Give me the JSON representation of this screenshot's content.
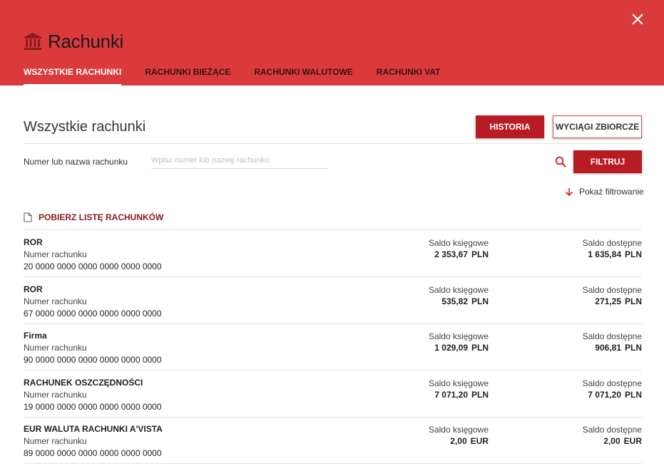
{
  "header": {
    "title": "Rachunki",
    "tabs": [
      {
        "label": "WSZYSTKIE RACHUNKI",
        "active": true
      },
      {
        "label": "RACHUNKI BIEŻĄCE",
        "active": false
      },
      {
        "label": "RACHUNKI WALUTOWE",
        "active": false
      },
      {
        "label": "RACHUNKI VAT",
        "active": false
      }
    ],
    "colors": {
      "background": "#db3a3d",
      "accent": "#b71c24"
    },
    "icons": {
      "title": "bank-icon",
      "close": "close-icon"
    }
  },
  "main": {
    "title": "Wszystkie rachunki",
    "history_button": "HISTORIA",
    "statements_button": "WYCIĄGI ZBIORCZE",
    "filter": {
      "label": "Numer lub nazwa rachunku",
      "value": "",
      "placeholder": "Wpisz numer lub nazwę rachunku",
      "submit_button": "FILTRUJ",
      "show_filtering": "Pokaż filtrowanie"
    },
    "download_list": "POBIERZ LISTĘ RACHUNKÓW",
    "accounts": [
      {
        "name": "ROR",
        "number_label": "Numer rachunku",
        "number": "20 0000 0000 0000 0000 0000 0000",
        "book_label": "Saldo księgowe",
        "book_amount": "2 353,67",
        "book_currency": "PLN",
        "avail_label": "Saldo dostępne",
        "avail_amount": "1 635,84",
        "avail_currency": "PLN"
      },
      {
        "name": "ROR",
        "number_label": "Numer rachunku",
        "number": "67 0000 0000 0000 0000 0000 0000",
        "book_label": "Saldo księgowe",
        "book_amount": "535,82",
        "book_currency": "PLN",
        "avail_label": "Saldo dostępne",
        "avail_amount": "271,25",
        "avail_currency": "PLN"
      },
      {
        "name": "Firma",
        "number_label": "Numer rachunku",
        "number": "90 0000 0000 0000 0000 0000 0000",
        "book_label": "Saldo księgowe",
        "book_amount": "1 029,09",
        "book_currency": "PLN",
        "avail_label": "Saldo dostępne",
        "avail_amount": "906,81",
        "avail_currency": "PLN"
      },
      {
        "name": "RACHUNEK OSZCZĘDNOŚCI",
        "number_label": "Numer rachunku",
        "number": "19 0000 0000 0000 0000 0000 0000",
        "book_label": "Saldo księgowe",
        "book_amount": "7 071,20",
        "book_currency": "PLN",
        "avail_label": "Saldo dostępne",
        "avail_amount": "7 071,20",
        "avail_currency": "PLN"
      },
      {
        "name": "EUR WALUTA RACHUNKI A'VISTA",
        "number_label": "Numer rachunku",
        "number": "89 0000 0000 0000 0000 0000 0000",
        "book_label": "Saldo księgowe",
        "book_amount": "2,00",
        "book_currency": "EUR",
        "avail_label": "Saldo dostępne",
        "avail_amount": "2,00",
        "avail_currency": "EUR"
      }
    ]
  }
}
